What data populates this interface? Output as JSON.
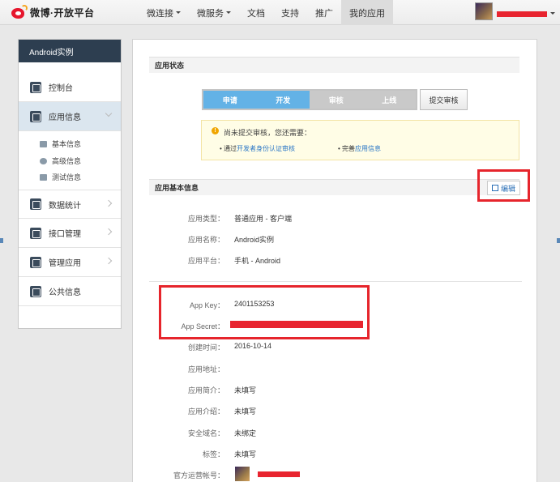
{
  "header": {
    "logo_text": "微博·开放平台",
    "nav": [
      {
        "label": "微连接",
        "dropdown": true
      },
      {
        "label": "微服务",
        "dropdown": true
      },
      {
        "label": "文档",
        "dropdown": false
      },
      {
        "label": "支持",
        "dropdown": false
      },
      {
        "label": "推广",
        "dropdown": false
      },
      {
        "label": "我的应用",
        "dropdown": false,
        "active": true
      }
    ]
  },
  "sidebar": {
    "title": "Android实例",
    "items": [
      {
        "label": "控制台",
        "icon": "console-icon"
      },
      {
        "label": "应用信息",
        "icon": "gear-icon",
        "active": true,
        "expanded": true
      },
      {
        "label": "数据统计",
        "icon": "chart-icon"
      },
      {
        "label": "接口管理",
        "icon": "plug-icon"
      },
      {
        "label": "管理应用",
        "icon": "layers-icon"
      },
      {
        "label": "公共信息",
        "icon": "sliders-icon"
      }
    ],
    "sub_items": [
      {
        "label": "基本信息",
        "icon": "card-icon"
      },
      {
        "label": "高级信息",
        "icon": "info-icon"
      },
      {
        "label": "测试信息",
        "icon": "user-card-icon"
      }
    ]
  },
  "status_section": {
    "title": "应用状态",
    "steps": [
      {
        "label": "申请",
        "done": true
      },
      {
        "label": "开发",
        "done": true
      },
      {
        "label": "审核",
        "done": false
      },
      {
        "label": "上线",
        "done": false
      }
    ],
    "submit_label": "提交审核",
    "notice": {
      "title": "尚未提交审核，您还需要：",
      "link1_prefix": "• 通过",
      "link1_text": "开发者身份认证审核",
      "link2_prefix": "• 完善",
      "link2_text": "应用信息"
    }
  },
  "basic_section": {
    "title": "应用基本信息",
    "edit_label": "编辑",
    "rows": [
      {
        "label": "应用类型：",
        "value": "普通应用  -  客户端"
      },
      {
        "label": "应用名称：",
        "value": "Android实例"
      },
      {
        "label": "应用平台：",
        "value": "手机  -  Android"
      }
    ],
    "detail_rows": [
      {
        "label": "App Key：",
        "value": "2401153253"
      },
      {
        "label": "App Secret：",
        "value": ""
      },
      {
        "label": "创建时间：",
        "value": "2016-10-14"
      },
      {
        "label": "应用地址：",
        "value": ""
      },
      {
        "label": "应用简介：",
        "value": "未填写"
      },
      {
        "label": "应用介绍：",
        "value": "未填写"
      },
      {
        "label": "安全域名：",
        "value": "未绑定"
      },
      {
        "label": "标签：",
        "value": "未填写"
      },
      {
        "label": "官方运营帐号：",
        "value": ""
      }
    ]
  },
  "colors": {
    "accent": "#63b2e6",
    "sidebar_header": "#2d3e50",
    "highlight_red": "#e6252c"
  }
}
